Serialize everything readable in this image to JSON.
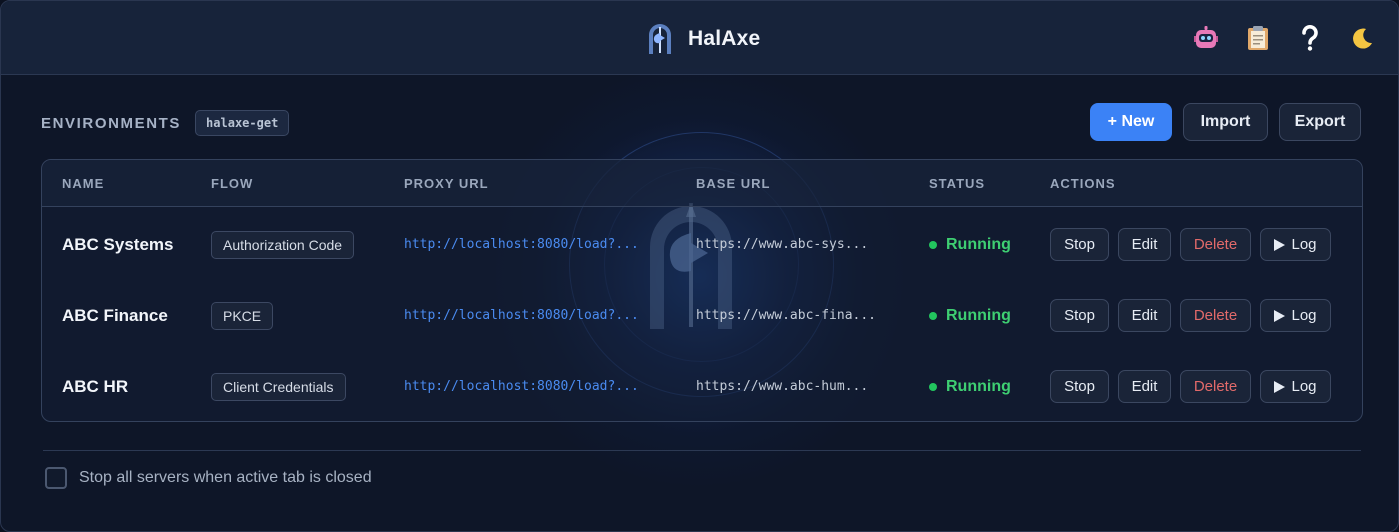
{
  "app": {
    "title": "HalAxe"
  },
  "header": {
    "icons": [
      {
        "name": "robot-icon",
        "color": "#e879b8"
      },
      {
        "name": "clipboard-icon",
        "color": "#e0a86a"
      },
      {
        "name": "help-icon",
        "color": "#ffffff"
      },
      {
        "name": "moon-icon",
        "color": "#f4c542"
      }
    ]
  },
  "environments": {
    "label": "ENVIRONMENTS",
    "tag": "halaxe-get",
    "buttons": {
      "new": "+ New",
      "import": "Import",
      "export": "Export"
    }
  },
  "table": {
    "columns": [
      "NAME",
      "FLOW",
      "PROXY URL",
      "BASE URL",
      "STATUS",
      "ACTIONS"
    ],
    "rows": [
      {
        "name": "ABC Systems",
        "flow": "Authorization Code",
        "proxy_url": "http://localhost:8080/load?...",
        "base_url": "https://www.abc-sys...",
        "status": "Running"
      },
      {
        "name": "ABC Finance",
        "flow": "PKCE",
        "proxy_url": "http://localhost:8080/load?...",
        "base_url": "https://www.abc-fina...",
        "status": "Running"
      },
      {
        "name": "ABC HR",
        "flow": "Client Credentials",
        "proxy_url": "http://localhost:8080/load?...",
        "base_url": "https://www.abc-hum...",
        "status": "Running"
      }
    ],
    "actions": {
      "stop": "Stop",
      "edit": "Edit",
      "delete": "Delete",
      "log": "Log"
    }
  },
  "footer": {
    "checkbox_label": "Stop all servers when active tab is closed",
    "checked": false
  },
  "colors": {
    "accent": "#3b82f6",
    "running": "#3ecf72",
    "danger": "#e26a6a",
    "link": "#4a8bf0"
  }
}
